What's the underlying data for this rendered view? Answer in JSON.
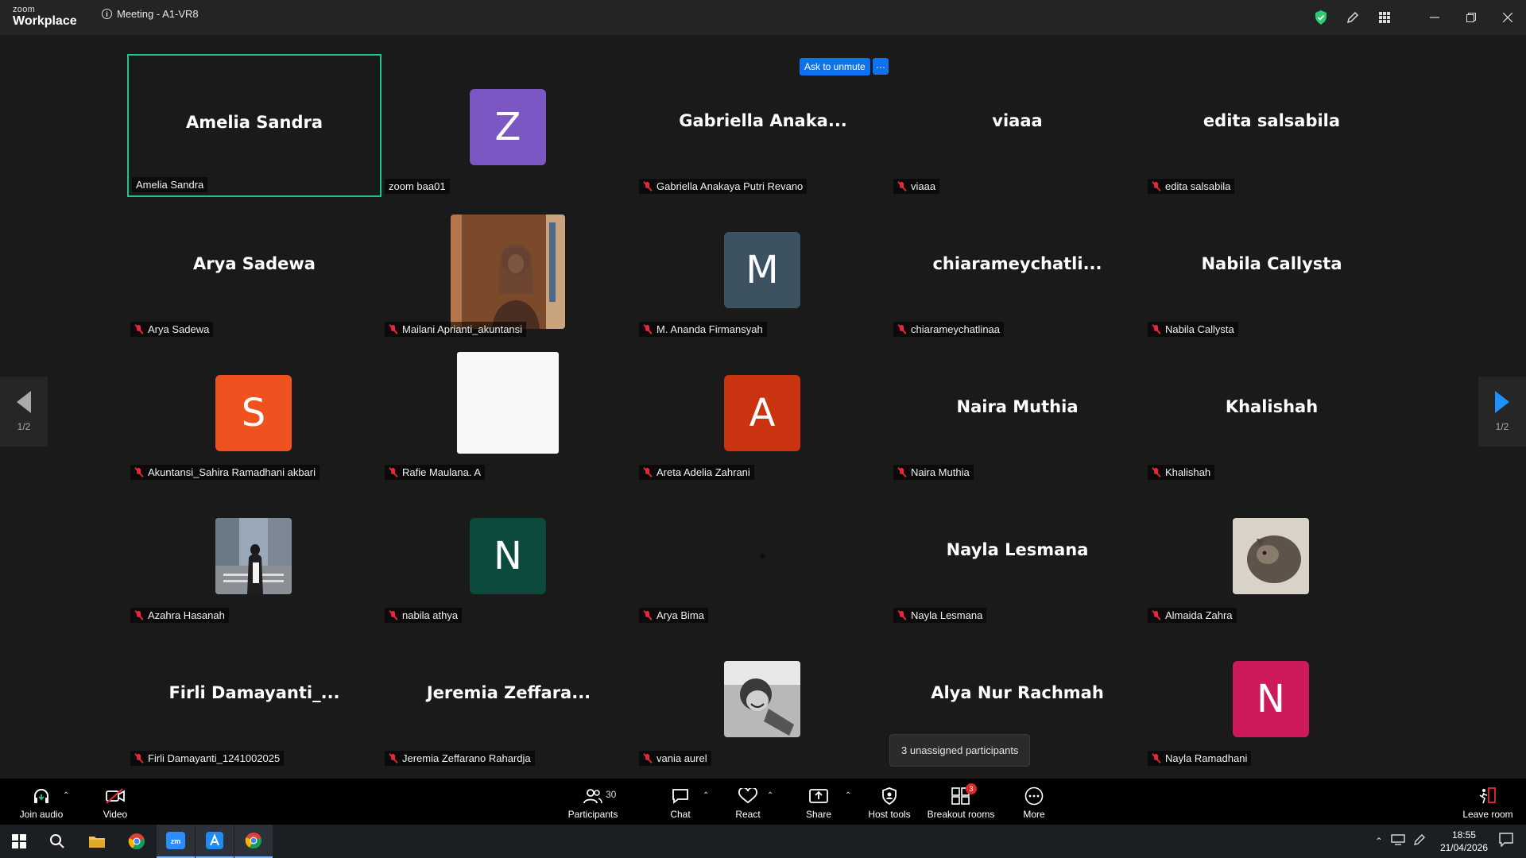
{
  "app": {
    "brand_small": "zoom",
    "brand_name": "Workplace",
    "meeting_title": "Meeting - A1-VR8"
  },
  "controls": {
    "ask_to_unmute": "Ask to unmute",
    "more": "···"
  },
  "pagination": {
    "left": "1/2",
    "right": "1/2"
  },
  "participants": [
    {
      "big": "Amelia Sandra",
      "label": "Amelia Sandra",
      "muted": false,
      "active": true,
      "kind": "name"
    },
    {
      "big": "Z",
      "label": "zoom baa01",
      "muted": false,
      "kind": "avatar",
      "color": "#7b57c4"
    },
    {
      "big": "Gabriella  Anaka...",
      "label": "Gabriella Anakaya Putri Revano",
      "muted": true,
      "kind": "name"
    },
    {
      "big": "viaaa",
      "label": "viaaa",
      "muted": true,
      "kind": "name"
    },
    {
      "big": "edita salsabila",
      "label": "edita salsabila",
      "muted": true,
      "kind": "name"
    },
    {
      "big": "Arya Sadewa",
      "label": "Arya Sadewa",
      "muted": true,
      "kind": "name"
    },
    {
      "big": "",
      "label": "Mailani Aprianti_akuntansi",
      "muted": true,
      "kind": "photo-portrait"
    },
    {
      "big": "M",
      "label": "M. Ananda Firmansyah",
      "muted": true,
      "kind": "avatar",
      "color": "#3d5260"
    },
    {
      "big": "chiarameychatli...",
      "label": "chiarameychatlinaa",
      "muted": true,
      "kind": "name"
    },
    {
      "big": "Nabila Callysta",
      "label": "Nabila Callysta",
      "muted": true,
      "kind": "name"
    },
    {
      "big": "S",
      "label": "Akuntansi_Sahira Ramadhani akbari",
      "muted": true,
      "kind": "avatar",
      "color": "#f0521f"
    },
    {
      "big": "",
      "label": "Rafie Maulana. A",
      "muted": true,
      "kind": "photo-white"
    },
    {
      "big": "A",
      "label": "Areta Adelia Zahrani",
      "muted": true,
      "kind": "avatar",
      "color": "#c9330f"
    },
    {
      "big": "Naira Muthia",
      "label": "Naira Muthia",
      "muted": true,
      "kind": "name"
    },
    {
      "big": "Khalishah",
      "label": "Khalishah",
      "muted": true,
      "kind": "name"
    },
    {
      "big": "",
      "label": "Azahra Hasanah",
      "muted": true,
      "kind": "photo-street"
    },
    {
      "big": "N",
      "label": "nabila athya",
      "muted": true,
      "kind": "avatar",
      "color": "#0b4a3c"
    },
    {
      "big": "",
      "label": "Arya Bima",
      "muted": true,
      "kind": "dot"
    },
    {
      "big": "Nayla Lesmana",
      "label": "Nayla Lesmana",
      "muted": true,
      "kind": "name"
    },
    {
      "big": "",
      "label": "Almaida Zahra",
      "muted": true,
      "kind": "photo-cat"
    },
    {
      "big": "Firli  Damayanti_...",
      "label": "Firli Damayanti_1241002025",
      "muted": true,
      "kind": "name"
    },
    {
      "big": "Jeremia  Zeffara...",
      "label": "Jeremia Zeffarano Rahardja",
      "muted": true,
      "kind": "name"
    },
    {
      "big": "",
      "label": "vania aurel",
      "muted": true,
      "kind": "photo-bw"
    },
    {
      "big": "Alya Nur Rachmah",
      "label": "",
      "muted": false,
      "kind": "name"
    },
    {
      "big": "N",
      "label": "Nayla Ramadhani",
      "muted": true,
      "kind": "avatar",
      "color": "#cc1a5c"
    }
  ],
  "tooltip": "3 unassigned participants",
  "toolbar": {
    "join_audio": "Join audio",
    "video": "Video",
    "participants": "Participants",
    "participants_count": "30",
    "chat": "Chat",
    "react": "React",
    "share": "Share",
    "host_tools": "Host tools",
    "breakout_rooms": "Breakout rooms",
    "breakout_badge": "3",
    "more": "More",
    "leave_room": "Leave room"
  },
  "taskbar": {
    "time": "18:55",
    "date": "21/04/2026"
  },
  "colors": {
    "accent": "#0e72ed",
    "active_border": "#22c38a",
    "mute": "#e8283a"
  }
}
